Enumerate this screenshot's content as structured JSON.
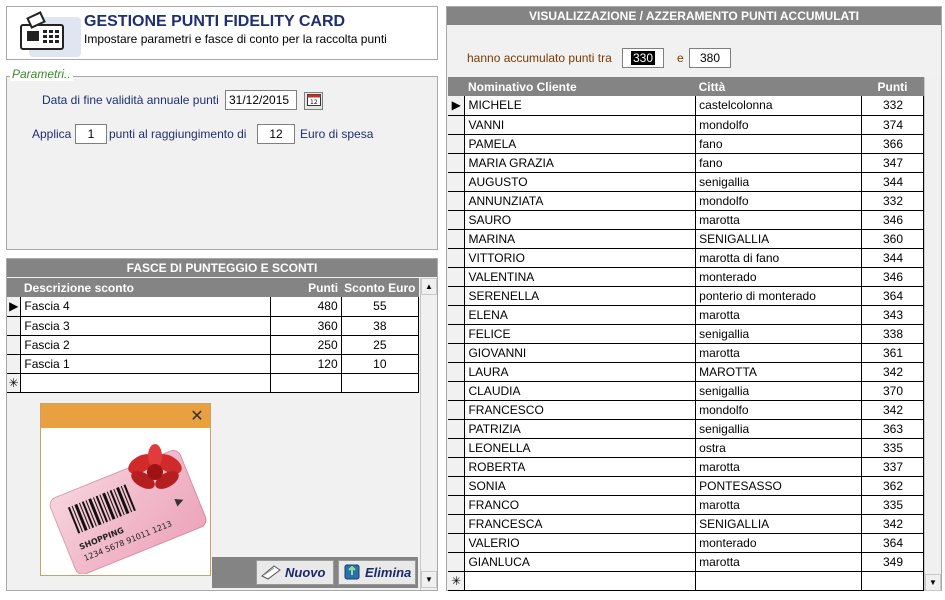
{
  "header": {
    "title": "GESTIONE PUNTI FIDELITY CARD",
    "subtitle": "Impostare parametri e fasce di conto per la raccolta punti"
  },
  "params": {
    "legend": "Parametri..",
    "date_label": "Data di fine validità annuale punti",
    "date_value": "31/12/2015",
    "applica_label": "Applica",
    "punti_value": "1",
    "punti_label": "punti al raggiungimento di",
    "euro_value": "12",
    "euro_label": "Euro di spesa"
  },
  "fasce": {
    "section_title": "FASCE DI PUNTEGGIO E SCONTI",
    "columns": [
      "Descrizione sconto",
      "Punti",
      "Sconto Euro"
    ],
    "rows": [
      {
        "desc": "Fascia 4",
        "punti": "480",
        "sconto": "55"
      },
      {
        "desc": "Fascia 3",
        "punti": "360",
        "sconto": "38"
      },
      {
        "desc": "Fascia 2",
        "punti": "250",
        "sconto": "25"
      },
      {
        "desc": "Fascia 1",
        "punti": "120",
        "sconto": "10"
      }
    ],
    "new_row_marker": "✳",
    "buttons": {
      "nuovo": "Nuovo",
      "elimina": "Elimina"
    }
  },
  "promo": {
    "card_label": "SHOPPING",
    "card_number": "1234 5678 91011 1213"
  },
  "right": {
    "section_title": "VISUALIZZAZIONE / AZZERAMENTO PUNTI ACCUMULATI",
    "range_label": "hanno accumulato punti tra",
    "range_from": "330",
    "range_and": "e",
    "range_to": "380",
    "columns": [
      "Nominativo Cliente",
      "Città",
      "Punti"
    ],
    "rows": [
      {
        "nome": "MICHELE",
        "citta": "castelcolonna",
        "punti": "332"
      },
      {
        "nome": "VANNI",
        "citta": "mondolfo",
        "punti": "374"
      },
      {
        "nome": "PAMELA",
        "citta": "fano",
        "punti": "366"
      },
      {
        "nome": "MARIA GRAZIA",
        "citta": "fano",
        "punti": "347"
      },
      {
        "nome": "AUGUSTO",
        "citta": "senigallia",
        "punti": "344"
      },
      {
        "nome": "ANNUNZIATA",
        "citta": "mondolfo",
        "punti": "332"
      },
      {
        "nome": "SAURO",
        "citta": "marotta",
        "punti": "346"
      },
      {
        "nome": "MARINA",
        "citta": "SENIGALLIA",
        "punti": "360"
      },
      {
        "nome": "VITTORIO",
        "citta": "marotta di fano",
        "punti": "344"
      },
      {
        "nome": "VALENTINA",
        "citta": "monterado",
        "punti": "346"
      },
      {
        "nome": "SERENELLA",
        "citta": "ponterio di monterado",
        "punti": "364"
      },
      {
        "nome": "ELENA",
        "citta": "marotta",
        "punti": "343"
      },
      {
        "nome": "FELICE",
        "citta": "senigallia",
        "punti": "338"
      },
      {
        "nome": "GIOVANNI",
        "citta": "marotta",
        "punti": "361"
      },
      {
        "nome": "LAURA",
        "citta": "MAROTTA",
        "punti": "342"
      },
      {
        "nome": "CLAUDIA",
        "citta": "senigallia",
        "punti": "370"
      },
      {
        "nome": "FRANCESCO",
        "citta": "mondolfo",
        "punti": "342"
      },
      {
        "nome": "PATRIZIA",
        "citta": "senigallia",
        "punti": "363"
      },
      {
        "nome": "LEONELLA",
        "citta": "ostra",
        "punti": "335"
      },
      {
        "nome": "ROBERTA",
        "citta": "marotta",
        "punti": "337"
      },
      {
        "nome": "SONIA",
        "citta": "PONTESASSO",
        "punti": "362"
      },
      {
        "nome": "FRANCO",
        "citta": "marotta",
        "punti": "335"
      },
      {
        "nome": "FRANCESCA",
        "citta": "SENIGALLIA",
        "punti": "342"
      },
      {
        "nome": "VALERIO",
        "citta": "monterado",
        "punti": "364"
      },
      {
        "nome": "GIANLUCA",
        "citta": "marotta",
        "punti": "349"
      }
    ],
    "new_row_marker": "✳"
  }
}
